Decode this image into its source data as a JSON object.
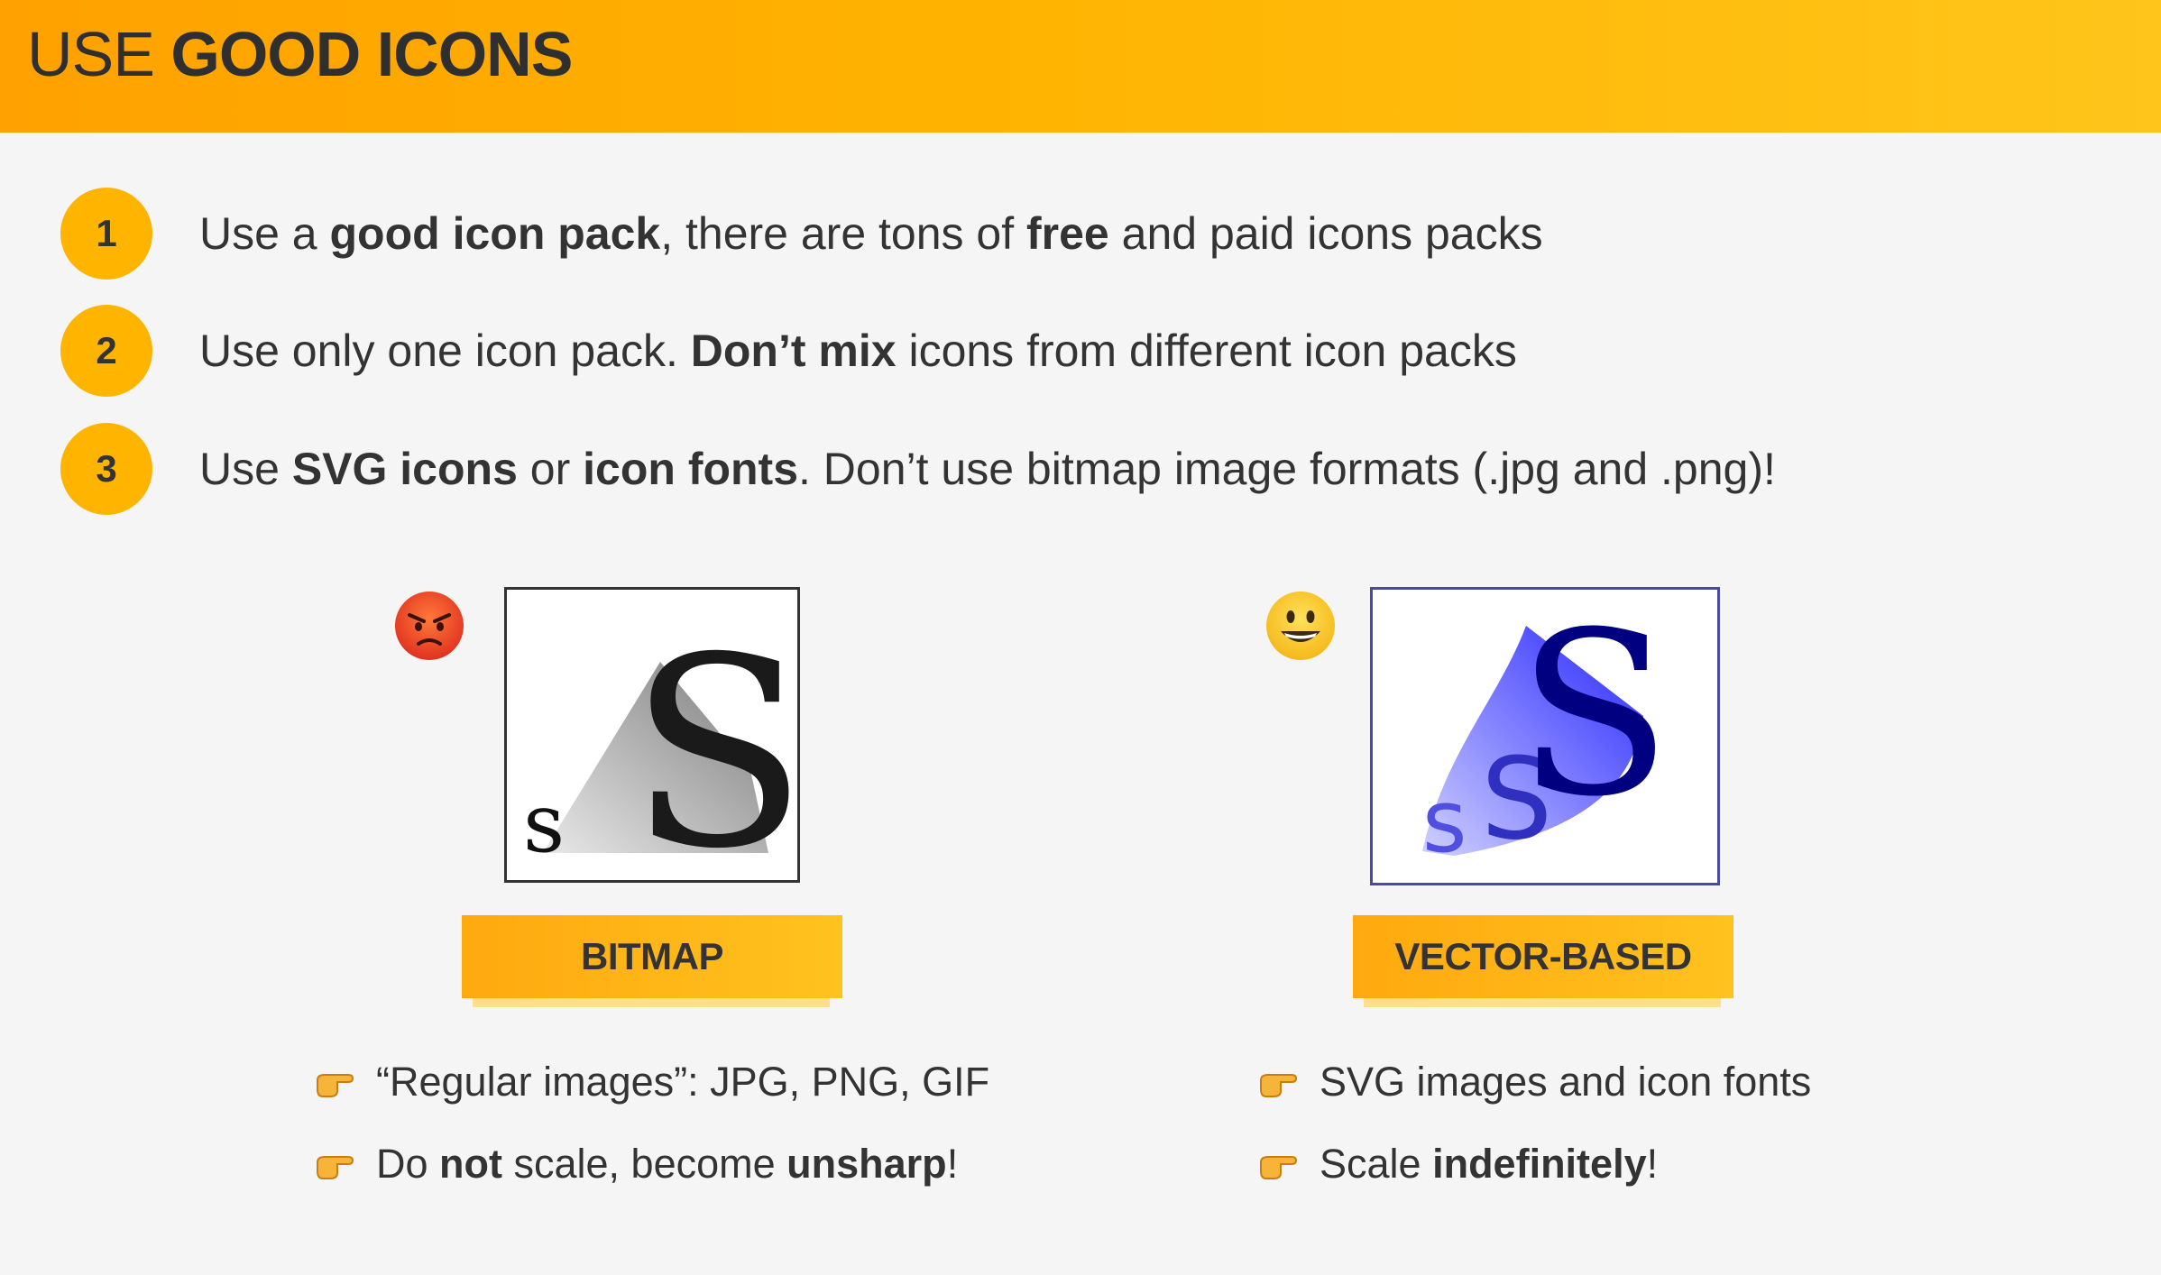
{
  "header": {
    "title_normal": "USE ",
    "title_bold": "GOOD ICONS"
  },
  "points": [
    {
      "num": "1",
      "parts": [
        "Use a ",
        "good icon pack",
        ", there are tons of ",
        "free",
        " and paid icons packs"
      ]
    },
    {
      "num": "2",
      "parts": [
        "Use only one icon pack. ",
        "Don’t mix",
        " icons from different icon packs"
      ]
    },
    {
      "num": "3",
      "parts": [
        "Use ",
        "SVG icons",
        " or ",
        "icon fonts",
        ". Don’t use bitmap image formats (.jpg and .png)!"
      ]
    }
  ],
  "bitmap": {
    "emoji": "angry-face-icon",
    "label": "BITMAP",
    "image_small_letter": "s",
    "image_big_letter": "S",
    "bullets": [
      {
        "parts": [
          "“Regular images”: JPG, PNG, GIF"
        ]
      },
      {
        "parts": [
          "Do ",
          "not",
          " scale, become ",
          "unsharp",
          "!"
        ]
      }
    ]
  },
  "vector": {
    "emoji": "smiling-face-icon",
    "label": "VECTOR-BASED",
    "image_small_letter": "s",
    "image_mid_letter": "S",
    "image_big_letter": "S",
    "bullets": [
      {
        "parts": [
          "SVG images and icon fonts"
        ]
      },
      {
        "parts": [
          "Scale ",
          "indefinitely",
          "!"
        ]
      }
    ]
  },
  "colors": {
    "accent": "#ffb400",
    "text": "#333333",
    "background": "#f5f5f5",
    "vector_blue": "#000080"
  }
}
